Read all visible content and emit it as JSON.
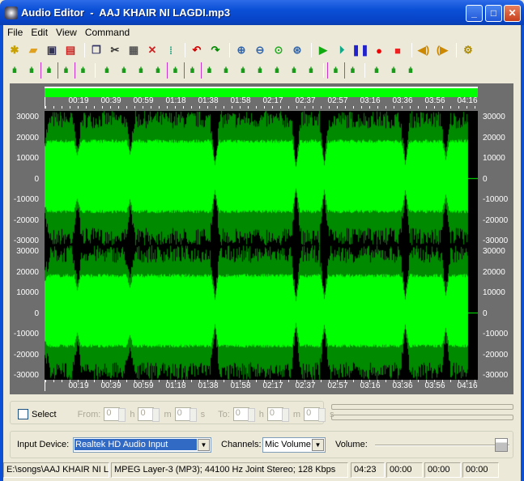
{
  "window": {
    "title": "Audio Editor  -  AAJ KHAIR NI LAGDI.mp3",
    "buttons": [
      "minimize",
      "maximize",
      "close"
    ]
  },
  "menu": [
    {
      "label": "File",
      "key": "F"
    },
    {
      "label": "Edit",
      "key": "E"
    },
    {
      "label": "View",
      "key": "V"
    },
    {
      "label": "Command",
      "key": "C"
    }
  ],
  "toolbar1": [
    "new-icon",
    "open-icon",
    "save-icon",
    "close-file-icon",
    "|",
    "copy-icon",
    "cut-icon",
    "paste-icon",
    "delete-icon",
    "insert-silence-icon",
    "|",
    "undo-icon",
    "redo-icon",
    "|",
    "zoom-in-icon",
    "zoom-out-icon",
    "zoom-selection-icon",
    "zoom-all-icon",
    "|",
    "play-icon",
    "play-loop-icon",
    "pause-icon",
    "record-icon",
    "stop-icon",
    "|",
    "left-channel-icon",
    "right-channel-icon",
    "|",
    "settings-icon"
  ],
  "toolbar2": [
    "amplify-icon",
    "normalize-icon",
    "fade-in-icon",
    "fade-out-icon",
    "invert-icon",
    "|",
    "silence-icon",
    "echo-icon",
    "lock-icon",
    "expand-icon",
    "reverse-icon",
    "vibrato-icon",
    "band-icon",
    "stretch-icon",
    "eq-icon",
    "filter-icon",
    "mix-icon",
    "noise-icon",
    "wizard-icon",
    "|",
    "trim-left-icon",
    "trim-right-icon",
    "|",
    "marker-icon",
    "split-icon",
    "join-icon"
  ],
  "ruler": {
    "labels": [
      "00:19",
      "00:39",
      "00:59",
      "01:18",
      "01:38",
      "01:58",
      "02:17",
      "02:37",
      "02:57",
      "03:16",
      "03:36",
      "03:56",
      "04:16"
    ]
  },
  "axis": {
    "labels": [
      "30000",
      "20000",
      "10000",
      "0",
      "-10000",
      "-20000",
      "-30000"
    ]
  },
  "colors": {
    "wave_bright": "#00ff00",
    "wave_dark": "#008a00",
    "background": "#000000",
    "panel": "#6e6e6e"
  },
  "selection": {
    "checkbox_label": "Select",
    "checked": false,
    "from_label": "From:",
    "to_label": "To:",
    "h": "h",
    "m": "m",
    "s": "s",
    "from": [
      "0",
      "0",
      "0"
    ],
    "to": [
      "0",
      "0",
      "0"
    ]
  },
  "input": {
    "device_label": "Input Device:",
    "device_value": "Realtek HD Audio Input",
    "channels_label": "Channels:",
    "channels_value": "Mic Volume",
    "volume_label": "Volume:",
    "volume_level": 1.0
  },
  "status": {
    "path": "E:\\songs\\AAJ KHAIR NI LA",
    "format": "MPEG Layer-3 (MP3); 44100 Hz Joint Stereo; 128 Kbps",
    "duration": "04:23",
    "t1": "00:00",
    "t2": "00:00",
    "t3": "00:00"
  }
}
